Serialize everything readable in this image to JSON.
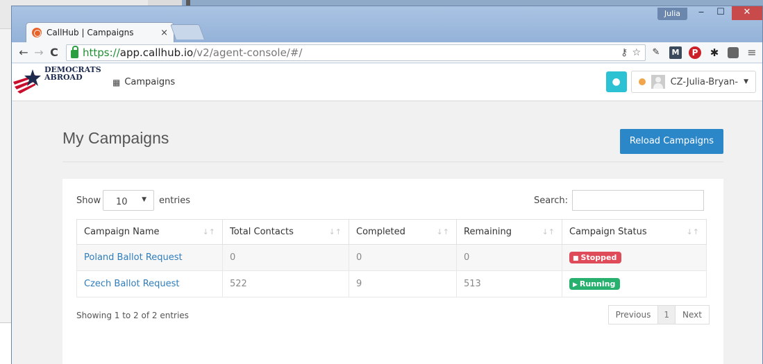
{
  "window": {
    "user_badge": "Julia",
    "min_glyph": "‒",
    "max_glyph": "☐",
    "close_glyph": "✕"
  },
  "tab": {
    "title": "CallHub | Campaigns",
    "close": "×"
  },
  "address": {
    "scheme": "https://",
    "host": "app.callhub.io",
    "path": "/v2/agent-console/#/"
  },
  "app": {
    "logo_line1": "DEMOCRATS",
    "logo_line2": "ABROAD",
    "nav_campaigns": "Campaigns",
    "user_name": "CZ-Julia-Bryan-",
    "status_color": "#f0a54a"
  },
  "page": {
    "title": "My Campaigns",
    "reload_button": "Reload Campaigns"
  },
  "table_controls": {
    "show_label": "Show",
    "entries_value": "10",
    "entries_label": "entries",
    "search_label": "Search:",
    "search_value": ""
  },
  "table": {
    "headers": [
      "Campaign Name",
      "Total Contacts",
      "Completed",
      "Remaining",
      "Campaign Status"
    ],
    "rows": [
      {
        "name": "Poland Ballot Request",
        "total": "0",
        "completed": "0",
        "remaining": "0",
        "status": "Stopped"
      },
      {
        "name": "Czech Ballot Request",
        "total": "522",
        "completed": "9",
        "remaining": "513",
        "status": "Running"
      }
    ]
  },
  "footer": {
    "info": "Showing 1 to 2 of 2 entries",
    "previous": "Previous",
    "page": "1",
    "next": "Next"
  },
  "colors": {
    "primary": "#2c87c9",
    "stopped": "#e04b5a",
    "running": "#27b06e",
    "accent": "#2dc1d4"
  }
}
